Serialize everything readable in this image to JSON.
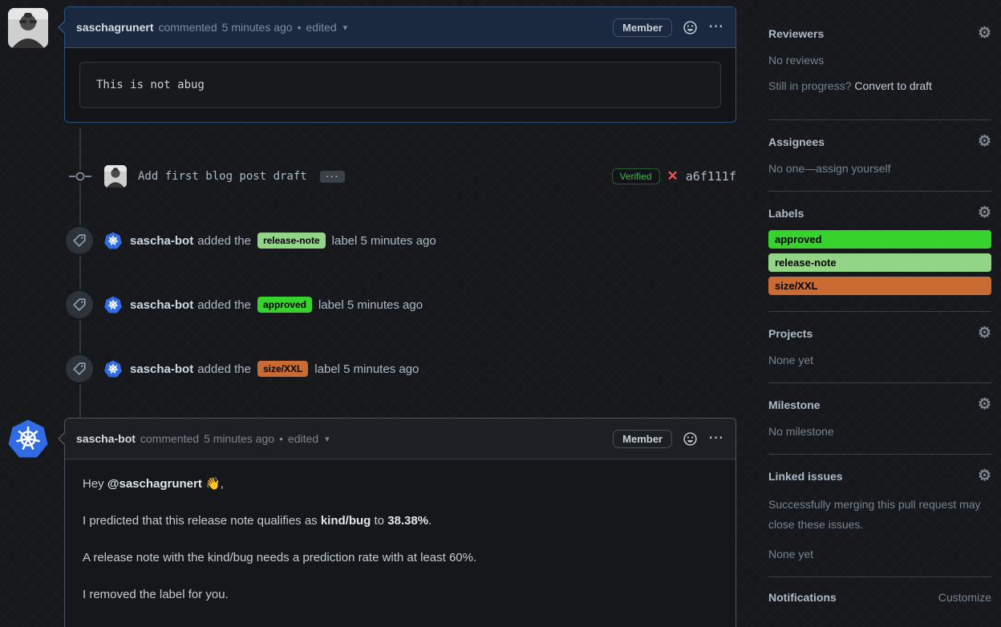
{
  "icons": {
    "gear": "⚙",
    "kebab": "⋯",
    "caret_down": "▾",
    "x_mark": "✕",
    "dot": "•"
  },
  "comment1": {
    "author": "saschagrunert",
    "action": "commented",
    "time": "5 minutes ago",
    "dot": "•",
    "edited": "edited",
    "member_badge": "Member",
    "code": "This is not abug"
  },
  "commit": {
    "message": "Add first blog post draft",
    "expander": "···",
    "verified": "Verified",
    "hash": "a6f111f"
  },
  "events": [
    {
      "author": "sascha-bot",
      "pre": "added the",
      "label": "release-note",
      "label_color": "#92d586",
      "post": "label 5 minutes ago"
    },
    {
      "author": "sascha-bot",
      "pre": "added the",
      "label": "approved",
      "label_color": "#35d32b",
      "post": "label 5 minutes ago"
    },
    {
      "author": "sascha-bot",
      "pre": "added the",
      "label": "size/XXL",
      "label_color": "#c96b33",
      "post": "label 5 minutes ago"
    }
  ],
  "comment2": {
    "author": "sascha-bot",
    "action": "commented",
    "time": "5 minutes ago",
    "dot": "•",
    "edited": "edited",
    "member_badge": "Member",
    "p1_pre": "Hey ",
    "p1_mention": "@saschagrunert",
    "p1_emoji": " 👋",
    "p1_post": ",",
    "p2_pre": "I predicted that this release note qualifies as ",
    "p2_bold1": "kind/bug",
    "p2_mid": " to ",
    "p2_bold2": "38.38%",
    "p2_post": ".",
    "p3": "A release note with the kind/bug needs a prediction rate with at least 60%.",
    "p4": "I removed the label for you."
  },
  "sidebar": {
    "reviewers": {
      "title": "Reviewers",
      "empty": "No reviews",
      "hint_pre": "Still in progress? ",
      "hint_link": "Convert to draft"
    },
    "assignees": {
      "title": "Assignees",
      "empty_pre": "No one—",
      "empty_link": "assign yourself"
    },
    "labels": {
      "title": "Labels",
      "items": [
        {
          "name": "approved",
          "color": "#35d32b"
        },
        {
          "name": "release-note",
          "color": "#92d586"
        },
        {
          "name": "size/XXL",
          "color": "#c96b33"
        }
      ]
    },
    "projects": {
      "title": "Projects",
      "empty": "None yet"
    },
    "milestone": {
      "title": "Milestone",
      "empty": "No milestone"
    },
    "linked_issues": {
      "title": "Linked issues",
      "description": "Successfully merging this pull request may close these issues.",
      "empty": "None yet"
    },
    "notifications": {
      "title": "Notifications",
      "customize": "Customize"
    }
  }
}
